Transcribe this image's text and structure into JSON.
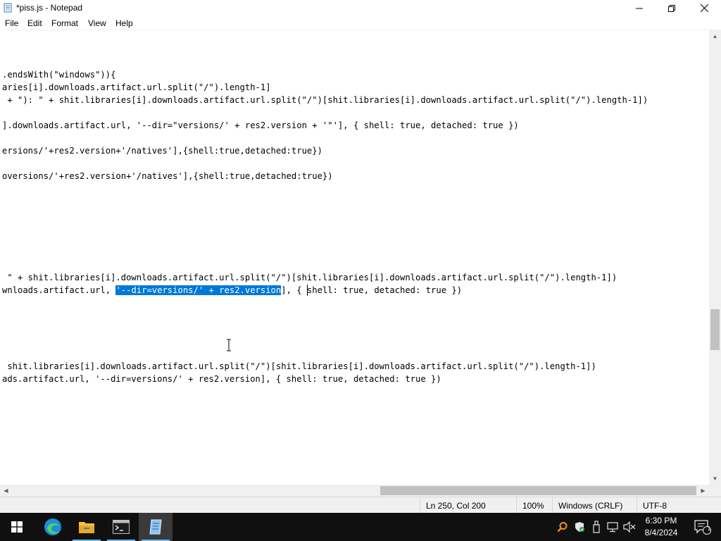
{
  "window": {
    "title": "*piss.js - Notepad",
    "icon": "notepad-icon",
    "controls": [
      "minimize-icon",
      "maximize-icon",
      "close-icon"
    ]
  },
  "menu": {
    "items": [
      "File",
      "Edit",
      "Format",
      "View",
      "Help"
    ]
  },
  "editor": {
    "lines": [
      {
        "text": ".endsWith(\"windows\")){"
      },
      {
        "text": "aries[i].downloads.artifact.url.split(\"/\").length-1]"
      },
      {
        "text": " + \"): \" + shit.libraries[i].downloads.artifact.url.split(\"/\")[shit.libraries[i].downloads.artifact.url.split(\"/\").length-1])"
      },
      {
        "text": "].downloads.artifact.url, '--dir=\"versions/' + res2.version + '\"'], { shell: true, detached: true })"
      },
      {
        "text": "ersions/'+res2.version+'/natives'],{shell:true,detached:true})"
      },
      {
        "text": "oversions/'+res2.version+'/natives'],{shell:true,detached:true})"
      },
      {
        "text": " \" + shit.libraries[i].downloads.artifact.url.split(\"/\")[shit.libraries[i].downloads.artifact.url.split(\"/\").length-1])"
      },
      {
        "before": "wnloads.artifact.url, ",
        "selected": "'--dir=versions/' + res2.version",
        "after": "], { shell: true, detached: true })"
      },
      {
        "text": " shit.libraries[i].downloads.artifact.url.split(\"/\")[shit.libraries[i].downloads.artifact.url.split(\"/\").length-1])"
      },
      {
        "text": "ads.artifact.url, '--dir=versions/' + res2.version], { shell: true, detached: true })"
      }
    ]
  },
  "statusbar": {
    "position": "Ln 250, Col 200",
    "zoom": "100%",
    "line_ending": "Windows (CRLF)",
    "encoding": "UTF-8"
  },
  "taskbar": {
    "apps": [
      "start-button",
      "edge-icon",
      "file-explorer-icon",
      "terminal-icon",
      "notepad-icon"
    ],
    "active_app": "notepad-icon",
    "tray": [
      "search-tray-icon",
      "defender-icon",
      "usb-icon",
      "network-icon",
      "volume-muted-icon"
    ],
    "time": "6:30 PM",
    "date": "8/4/2024",
    "notification_count": "1"
  },
  "colors": {
    "selection": "#0078d7",
    "taskbar": "#101010",
    "accent": "#76b9ed"
  }
}
